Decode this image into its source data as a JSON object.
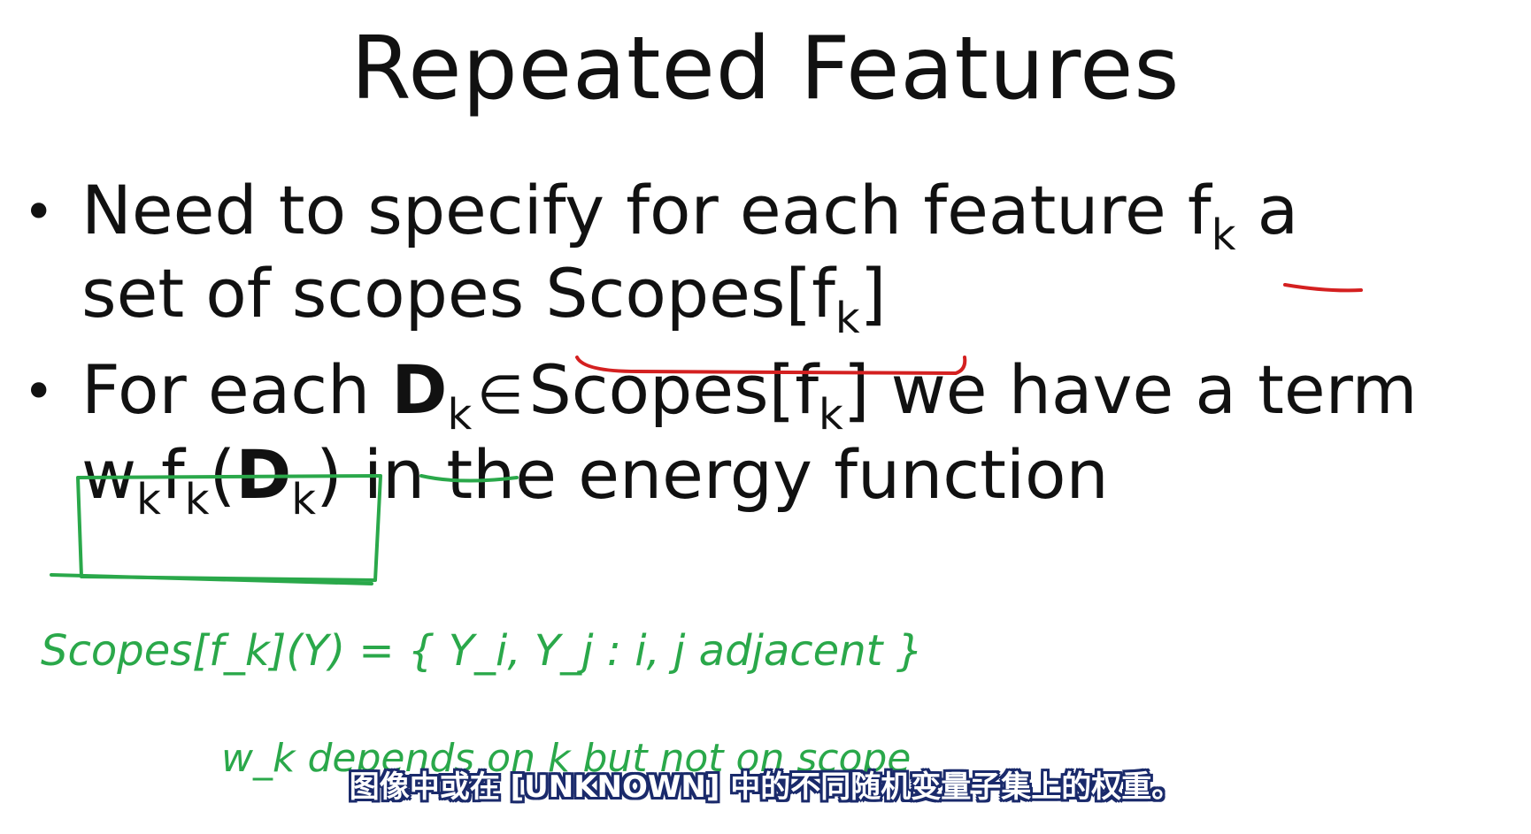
{
  "slide": {
    "title": "Repeated Features",
    "bullet_symbol": "•",
    "bullets": [
      {
        "line1": {
          "prefix": "Need to specify for each feature f",
          "sub": "k",
          "suffix": " a"
        },
        "line2": {
          "prefix": "set of scopes Scopes[f",
          "sub": "k",
          "suffix": "]"
        }
      },
      {
        "line1": {
          "prefix": "For each ",
          "d": "D",
          "sub1": "k",
          "elem": "∈",
          "scopes": "Scopes[f",
          "sub2": "k",
          "suffix": "] we have a term"
        },
        "line2": {
          "w": "w",
          "sub1": "k",
          "f": "f",
          "sub2": "k",
          "open": "(",
          "d": "D",
          "sub3": "k",
          "close": ")",
          "suffix": " in the energy function"
        }
      }
    ]
  },
  "annotations": {
    "color": "#2aa84a",
    "underline_color": "#d42020",
    "handwriting_line1": "Scopes[f_k](Y) = { Y_i, Y_j : i, j adjacent }",
    "handwriting_line2": "w_k depends on k but not on scope"
  },
  "subtitle": {
    "text": "图像中或在 [UNKNOWN] 中的不同随机变量子集上的权重。"
  }
}
